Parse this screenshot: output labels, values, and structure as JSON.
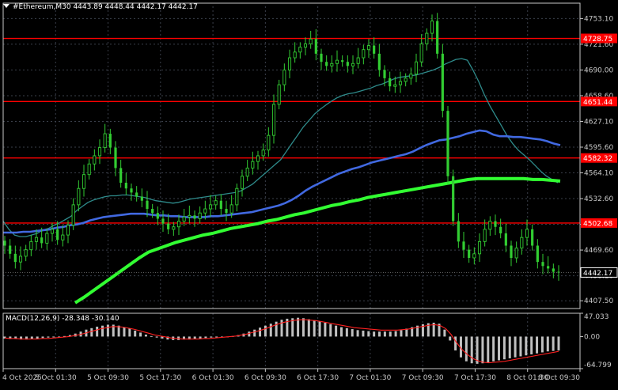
{
  "header": {
    "symbol_line": "#Ethereum,M30  4443.89 4448.44 4442.17 4442.17"
  },
  "colors": {
    "background": "#000000",
    "grid": "#3a3f4a",
    "axis": "#c8c8c8",
    "bull_candle": "#32cd32",
    "hline": "#ff0000",
    "ma_fast": "#2e8b8b",
    "ma_mid": "#4169e1",
    "ma_slow": "#32ff32",
    "macd_hist": "#c0c0c0",
    "macd_signal": "#ff2020"
  },
  "price_scale": {
    "ticks": [
      "4753.10",
      "4721.60",
      "4690.00",
      "4658.60",
      "4627.10",
      "4595.60",
      "4564.10",
      "4532.60",
      "4501.10",
      "4469.60",
      "4438.10",
      "4407.50"
    ]
  },
  "levels": [
    {
      "label": "4728.75",
      "value": 4728.75
    },
    {
      "label": "4651.44",
      "value": 4651.44
    },
    {
      "label": "4582.32",
      "value": 4582.32
    },
    {
      "label": "4502.68",
      "value": 4502.68
    }
  ],
  "current_price": {
    "label": "4442.17",
    "value": 4442.17
  },
  "macd": {
    "title": "MACD(12,26,9) -28.348 -30.140",
    "ticks": [
      "47.033",
      "0.00",
      "-64.799"
    ]
  },
  "time_axis": {
    "labels": [
      "4 Oct 2025",
      "5 Oct 01:30",
      "5 Oct 09:30",
      "5 Oct 17:30",
      "6 Oct 01:30",
      "6 Oct 09:30",
      "6 Oct 17:30",
      "7 Oct 01:30",
      "7 Oct 09:30",
      "7 Oct 17:30",
      "8 Oct 01:30",
      "8 Oct 09:30"
    ]
  },
  "chart_data": {
    "type": "candlestick",
    "series": [
      {
        "name": "#Ethereum,M30",
        "points": [
          4475,
          4465,
          4455,
          4462,
          4470,
          4480,
          4485,
          4478,
          4490,
          4495,
          4482,
          4488,
          4500,
          4525,
          4545,
          4562,
          4575,
          4585,
          4595,
          4612,
          4595,
          4570,
          4552,
          4545,
          4540,
          4535,
          4530,
          4520,
          4515,
          4508,
          4502,
          4495,
          4498,
          4505,
          4510,
          4512,
          4508,
          4515,
          4520,
          4525,
          4530,
          4520,
          4515,
          4525,
          4545,
          4560,
          4570,
          4578,
          4585,
          4592,
          4610,
          4648,
          4672,
          4690,
          4705,
          4712,
          4718,
          4722,
          4728,
          4710,
          4700,
          4695,
          4698,
          4702,
          4700,
          4695,
          4698,
          4705,
          4715,
          4720,
          4710,
          4690,
          4680,
          4670,
          4672,
          4676,
          4680,
          4685,
          4700,
          4722,
          4735,
          4750,
          4710,
          4640,
          4560,
          4505,
          4480,
          4470,
          4460,
          4465,
          4480,
          4495,
          4505,
          4498,
          4490,
          4475,
          4460,
          4472,
          4485,
          4495,
          4475,
          4455,
          4450,
          4447,
          4443,
          4442
        ]
      },
      {
        "name": "",
        "points": [
          4505,
          4495,
          4488,
          4486,
          4486,
          4488,
          4490,
          4494,
          4496,
          4500,
          4503,
          4507,
          4511,
          4518,
          4523,
          4528,
          4531,
          4533,
          4535,
          4536,
          4536,
          4537,
          4537,
          4536,
          4535,
          4534,
          4532,
          4530,
          4529,
          4528,
          4527,
          4528,
          4530,
          4532,
          4533,
          4534,
          4535,
          4536,
          4537,
          4538,
          4539,
          4540,
          4542,
          4546,
          4550,
          4556,
          4562,
          4568,
          4574,
          4580,
          4590,
          4600,
          4610,
          4620,
          4628,
          4636,
          4642,
          4647,
          4652,
          4656,
          4659,
          4661,
          4662,
          4664,
          4666,
          4668,
          4671,
          4673,
          4676,
          4679,
          4681,
          4682,
          4683,
          4684,
          4686,
          4688,
          4690,
          4693,
          4697,
          4700,
          4703,
          4704,
          4702,
          4690,
          4676,
          4660,
          4646,
          4634,
          4622,
          4610,
          4600,
          4592,
          4586,
          4580,
          4573,
          4566,
          4560,
          4556,
          4552
        ]
      },
      {
        "name": "",
        "points": [
          4491,
          4491,
          4491,
          4492,
          4492,
          4493,
          4494,
          4495,
          4497,
          4498,
          4500,
          4501,
          4503,
          4506,
          4508,
          4510,
          4511,
          4512,
          4513,
          4514,
          4514,
          4514,
          4513,
          4512,
          4512,
          4511,
          4511,
          4510,
          4510,
          4510,
          4510,
          4511,
          4511,
          4512,
          4513,
          4514,
          4515,
          4516,
          4518,
          4520,
          4522,
          4524,
          4527,
          4531,
          4536,
          4542,
          4547,
          4551,
          4555,
          4559,
          4563,
          4566,
          4569,
          4571,
          4574,
          4577,
          4579,
          4581,
          4583,
          4585,
          4587,
          4590,
          4594,
          4598,
          4601,
          4604,
          4605,
          4607,
          4609,
          4612,
          4614,
          4616,
          4615,
          4611,
          4609,
          4609,
          4608,
          4608,
          4607,
          4606,
          4605,
          4603,
          4600,
          4598
        ]
      },
      {
        "name": "",
        "points": [
          4405,
          4412,
          4420,
          4428,
          4436,
          4444,
          4452,
          4460,
          4467,
          4471,
          4475,
          4479,
          4482,
          4485,
          4488,
          4490,
          4493,
          4496,
          4498,
          4500,
          4502,
          4505,
          4507,
          4510,
          4513,
          4515,
          4518,
          4521,
          4524,
          4526,
          4529,
          4531,
          4534,
          4536,
          4538,
          4540,
          4542,
          4544,
          4546,
          4548,
          4550,
          4552,
          4554,
          4556,
          4557,
          4557,
          4557,
          4557,
          4557,
          4557,
          4556,
          4556,
          4555,
          4554
        ]
      }
    ],
    "ylim": [
      4398,
      4768
    ],
    "ytick_labels": [
      "4753.10",
      "4721.60",
      "4690.00",
      "4658.60",
      "4627.10",
      "4595.60",
      "4564.10",
      "4532.60",
      "4501.10",
      "4469.60",
      "4438.10",
      "4407.50"
    ],
    "xtick_labels": [
      "4 Oct 2025",
      "5 Oct 01:30",
      "5 Oct 09:30",
      "5 Oct 17:30",
      "6 Oct 01:30",
      "6 Oct 09:30",
      "6 Oct 17:30",
      "7 Oct 01:30",
      "7 Oct 09:30",
      "7 Oct 17:30",
      "8 Oct 01:30",
      "8 Oct 09:30"
    ],
    "hlines": [
      4728.75,
      4651.44,
      4582.32,
      4502.68
    ],
    "macd": {
      "ylim": [
        -64.799,
        47.033
      ],
      "histogram": [
        -4,
        -5,
        -5,
        -6,
        -6,
        -5,
        -4,
        -3,
        -2,
        -1,
        0,
        1,
        3,
        6,
        10,
        14,
        17,
        20,
        22,
        24,
        24,
        22,
        19,
        16,
        12,
        8,
        4,
        1,
        -2,
        -4,
        -6,
        -7,
        -7,
        -6,
        -6,
        -5,
        -4,
        -3,
        -2,
        -1,
        0,
        0,
        1,
        3,
        6,
        10,
        14,
        18,
        22,
        26,
        30,
        34,
        36,
        37,
        38,
        37,
        35,
        33,
        31,
        28,
        25,
        22,
        19,
        17,
        15,
        13,
        12,
        11,
        10,
        10,
        10,
        10,
        11,
        13,
        16,
        19,
        22,
        25,
        27,
        28,
        26,
        14,
        -8,
        -28,
        -42,
        -50,
        -54,
        -55,
        -54,
        -52,
        -50,
        -48,
        -46,
        -44,
        -42,
        -40,
        -38,
        -36,
        -34,
        -32,
        -30,
        -29,
        -28
      ],
      "signal": [
        -3,
        -4,
        -4,
        -5,
        -5,
        -5,
        -5,
        -4,
        -4,
        -3,
        -2,
        -1,
        0,
        2,
        4,
        7,
        10,
        13,
        16,
        18,
        20,
        20,
        19,
        17,
        15,
        12,
        9,
        6,
        3,
        1,
        -1,
        -3,
        -4,
        -5,
        -5,
        -5,
        -5,
        -4,
        -4,
        -3,
        -2,
        -1,
        0,
        1,
        3,
        5,
        8,
        11,
        14,
        18,
        22,
        26,
        29,
        31,
        33,
        34,
        34,
        33,
        32,
        30,
        28,
        26,
        24,
        22,
        20,
        18,
        17,
        16,
        15,
        14,
        13,
        13,
        13,
        13,
        14,
        15,
        17,
        19,
        21,
        23,
        24,
        22,
        16,
        4,
        -12,
        -26,
        -36,
        -44,
        -49,
        -52,
        -53,
        -52,
        -51,
        -50,
        -48,
        -46,
        -44,
        -42,
        -40,
        -38,
        -36,
        -34,
        -32,
        -30
      ]
    }
  }
}
